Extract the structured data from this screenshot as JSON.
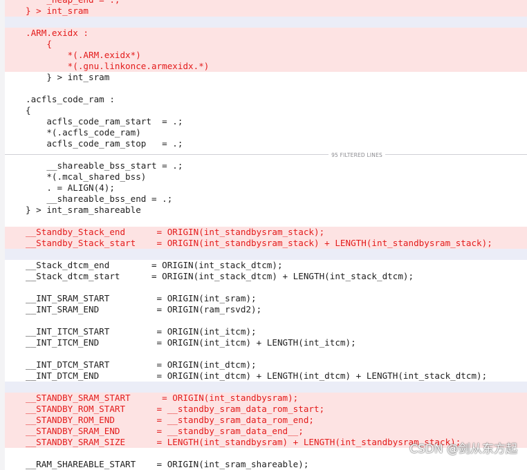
{
  "filter_label": "95 FILTERED LINES",
  "watermark": "CSDN @剑从东方起",
  "colors": {
    "deleted_bg": "#fde3e3",
    "deleted_text": "#e31b1b",
    "separator_bg": "#ebedf7"
  },
  "lines_before": [
    {
      "type": "del",
      "text": "    _heap_end = .;"
    },
    {
      "type": "del",
      "text": "} > int_sram"
    },
    {
      "type": "sep",
      "text": ""
    },
    {
      "type": "del",
      "text": ".ARM.exidx :"
    },
    {
      "type": "del",
      "text": "    {"
    },
    {
      "type": "del",
      "text": "        *(.ARM.exidx*)"
    },
    {
      "type": "del",
      "text": "        *(.gnu.linkonce.armexidx.*)"
    },
    {
      "type": "normal",
      "text": "    } > int_sram"
    },
    {
      "type": "blank",
      "text": ""
    },
    {
      "type": "normal",
      "text": ".acfls_code_ram :"
    },
    {
      "type": "normal",
      "text": "{"
    },
    {
      "type": "normal",
      "text": "    acfls_code_ram_start  = .;"
    },
    {
      "type": "normal",
      "text": "    *(.acfls_code_ram)"
    },
    {
      "type": "normal",
      "text": "    acfls_code_ram_stop   = .;"
    }
  ],
  "lines_after": [
    {
      "type": "normal",
      "text": "    __shareable_bss_start = .;"
    },
    {
      "type": "normal",
      "text": "    *(.mcal_shared_bss)"
    },
    {
      "type": "normal",
      "text": "    . = ALIGN(4);"
    },
    {
      "type": "normal",
      "text": "    __shareable_bss_end = .;"
    },
    {
      "type": "normal",
      "text": "} > int_sram_shareable"
    },
    {
      "type": "blank",
      "text": ""
    },
    {
      "type": "del",
      "text": "__Standby_Stack_end      = ORIGIN(int_standbysram_stack);"
    },
    {
      "type": "del",
      "text": "__Standby_Stack_start    = ORIGIN(int_standbysram_stack) + LENGTH(int_standbysram_stack);"
    },
    {
      "type": "sep",
      "text": ""
    },
    {
      "type": "normal",
      "text": "__Stack_dtcm_end        = ORIGIN(int_stack_dtcm);"
    },
    {
      "type": "normal",
      "text": "__Stack_dtcm_start      = ORIGIN(int_stack_dtcm) + LENGTH(int_stack_dtcm);"
    },
    {
      "type": "blank",
      "text": ""
    },
    {
      "type": "normal",
      "text": "__INT_SRAM_START         = ORIGIN(int_sram);"
    },
    {
      "type": "normal",
      "text": "__INT_SRAM_END           = ORIGIN(ram_rsvd2);"
    },
    {
      "type": "blank",
      "text": ""
    },
    {
      "type": "normal",
      "text": "__INT_ITCM_START         = ORIGIN(int_itcm);"
    },
    {
      "type": "normal",
      "text": "__INT_ITCM_END           = ORIGIN(int_itcm) + LENGTH(int_itcm);"
    },
    {
      "type": "blank",
      "text": ""
    },
    {
      "type": "normal",
      "text": "__INT_DTCM_START         = ORIGIN(int_dtcm);"
    },
    {
      "type": "normal",
      "text": "__INT_DTCM_END           = ORIGIN(int_dtcm) + LENGTH(int_dtcm) + LENGTH(int_stack_dtcm);"
    },
    {
      "type": "sep",
      "text": ""
    },
    {
      "type": "del",
      "text": "__STANDBY_SRAM_START      = ORIGIN(int_standbysram);"
    },
    {
      "type": "del",
      "text": "__STANDBY_ROM_START      = __standby_sram_data_rom_start;"
    },
    {
      "type": "del",
      "text": "__STANDBY_ROM_END        = __standby_sram_data_rom_end;"
    },
    {
      "type": "del",
      "text": "__STANDBY_SRAM_END       = __standby_sram_data_end__;"
    },
    {
      "type": "del",
      "text": "__STANDBY_SRAM_SIZE      = LENGTH(int_standbysram) + LENGTH(int_standbysram_stack);"
    },
    {
      "type": "blank",
      "text": ""
    },
    {
      "type": "normal",
      "text": "__RAM_SHAREABLE_START    = ORIGIN(int_sram_shareable);"
    }
  ]
}
